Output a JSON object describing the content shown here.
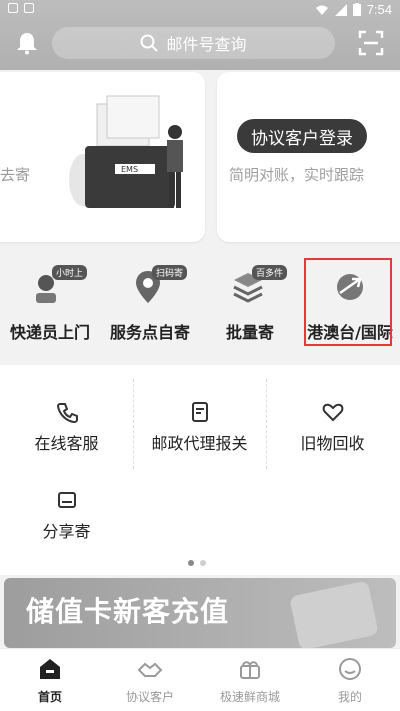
{
  "status_bar": {
    "time": "7:54"
  },
  "header": {
    "search_placeholder": "邮件号查询"
  },
  "cards": {
    "left_partial_text": "去寄",
    "right_button": "协议客户登录",
    "right_subtitle": "简明对账，实时跟踪"
  },
  "quick_services": [
    {
      "label": "快递员上门",
      "badge": "小时上"
    },
    {
      "label": "服务点自寄",
      "badge": "扫码寄"
    },
    {
      "label": "批量寄",
      "badge": "百多件"
    },
    {
      "label": "港澳台/国际",
      "badge": ""
    }
  ],
  "more_services": [
    {
      "label": "在线客服"
    },
    {
      "label": "邮政代理报关"
    },
    {
      "label": "旧物回收"
    },
    {
      "label": "分享寄"
    }
  ],
  "banner": {
    "title": "储值卡新客充值"
  },
  "tabbar": [
    {
      "label": "首页"
    },
    {
      "label": "协议客户"
    },
    {
      "label": "极速鲜商城"
    },
    {
      "label": "我的"
    }
  ]
}
